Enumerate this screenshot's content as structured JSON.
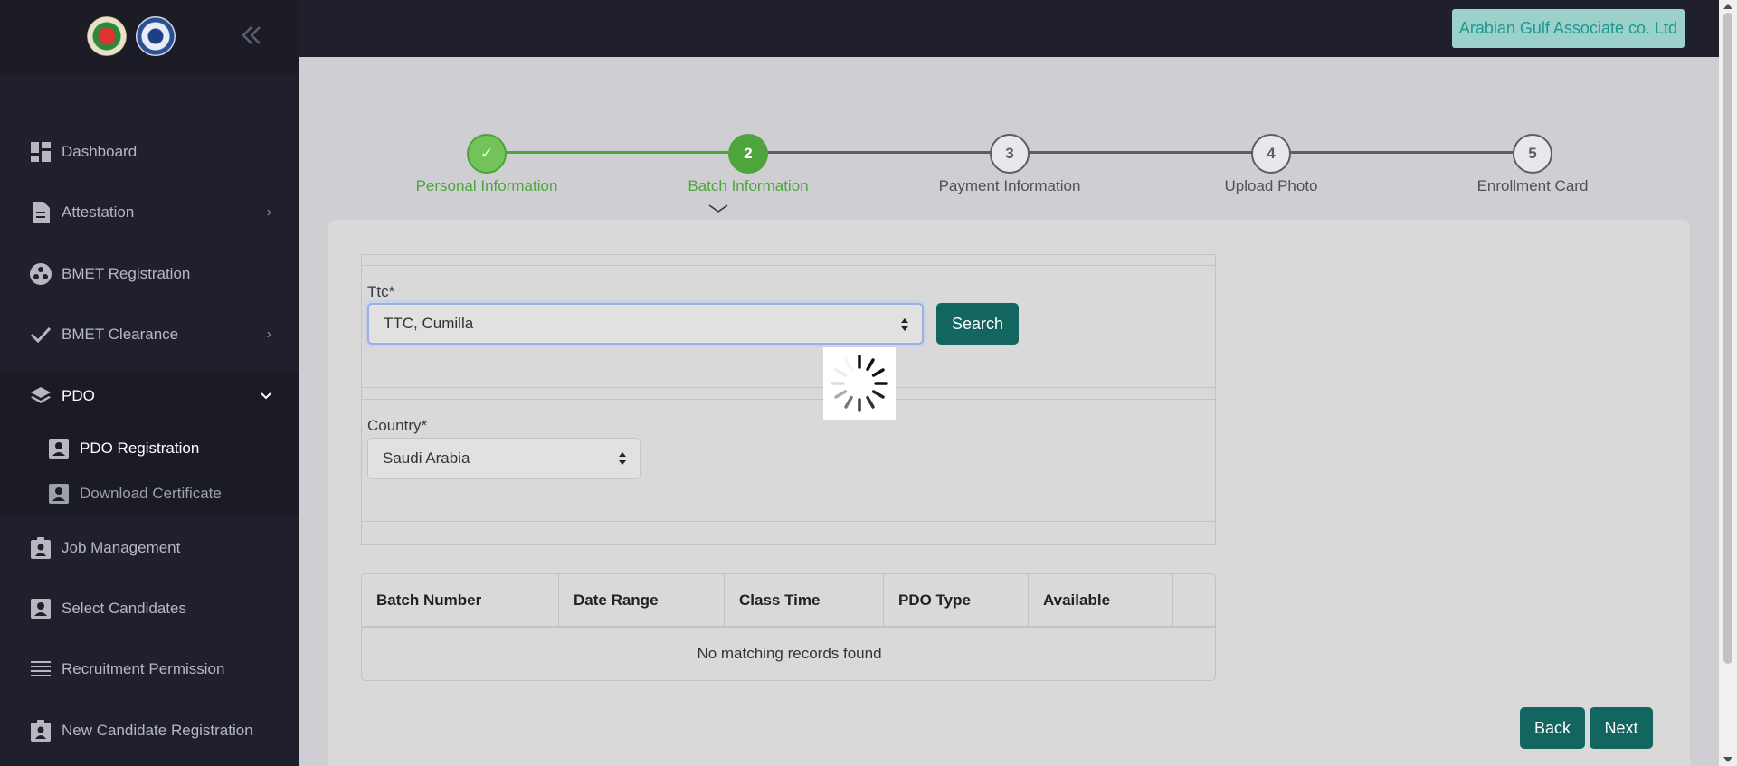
{
  "sidebar": {
    "items": [
      {
        "label": "Dashboard"
      },
      {
        "label": "Attestation"
      },
      {
        "label": "BMET Registration"
      },
      {
        "label": "BMET Clearance"
      },
      {
        "label": "PDO"
      },
      {
        "label": "Job Management"
      },
      {
        "label": "Select Candidates"
      },
      {
        "label": "Recruitment Permission"
      },
      {
        "label": "New Candidate Registration"
      }
    ],
    "pdo_sub_items": [
      {
        "label": "PDO Registration"
      },
      {
        "label": "Download Certificate"
      }
    ]
  },
  "header": {
    "organization": "Arabian Gulf Associate co. Ltd"
  },
  "stepper": {
    "steps": [
      {
        "number": "✓",
        "label": "Personal Information",
        "state": "done"
      },
      {
        "number": "2",
        "label": "Batch Information",
        "state": "active"
      },
      {
        "number": "3",
        "label": "Payment Information",
        "state": "todo"
      },
      {
        "number": "4",
        "label": "Upload Photo",
        "state": "todo"
      },
      {
        "number": "5",
        "label": "Enrollment Card",
        "state": "todo"
      }
    ]
  },
  "form": {
    "ttc_label": "Ttc*",
    "ttc_value": "TTC, Cumilla",
    "search_label": "Search",
    "country_label": "Country*",
    "country_value": "Saudi Arabia"
  },
  "table": {
    "columns": [
      "Batch Number",
      "Date Range",
      "Class Time",
      "PDO Type",
      "Available"
    ],
    "empty_text": "No matching records found"
  },
  "actions": {
    "back_label": "Back",
    "next_label": "Next"
  },
  "colors": {
    "sidebar_bg": "#1f202b",
    "primary_button": "#12665f",
    "step_complete": "#4ea53c",
    "badge_bg": "#9bd0cb"
  }
}
